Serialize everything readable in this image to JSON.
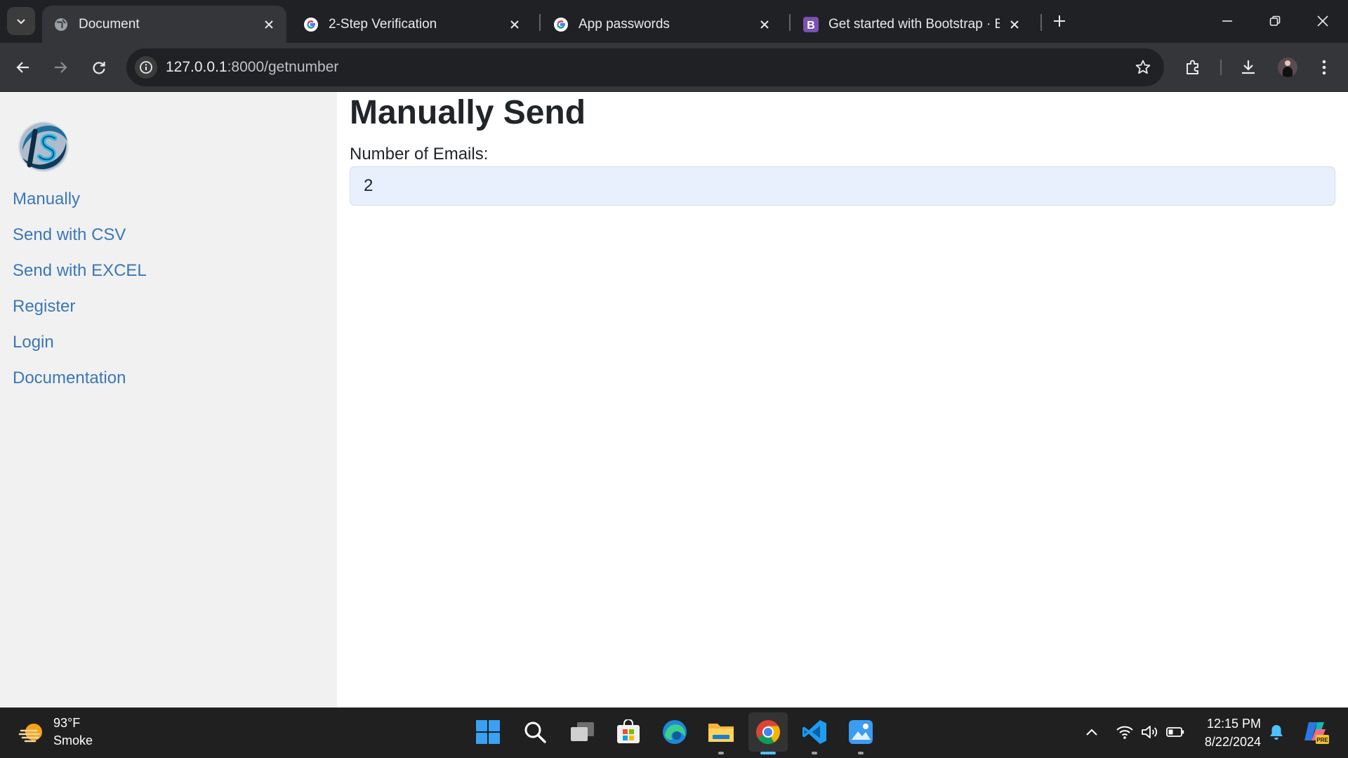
{
  "browser": {
    "tabs": [
      {
        "title": "Document",
        "active": true
      },
      {
        "title": "2-Step Verification",
        "active": false
      },
      {
        "title": "App passwords",
        "active": false
      },
      {
        "title": "Get started with Bootstrap · Bootstrap",
        "active": false
      }
    ],
    "bootstrap_favicon_letter": "B",
    "url_host": "127.0.0.1",
    "url_rest": ":8000/getnumber"
  },
  "sidebar": {
    "links": [
      "Manually",
      "Send with CSV",
      "Send with EXCEL",
      "Register",
      "Login",
      "Documentation"
    ]
  },
  "main": {
    "title": "Manually Send",
    "email_count_label": "Number of Emails:",
    "email_count_value": "2"
  },
  "taskbar": {
    "weather_temp": "93°F",
    "weather_condition": "Smoke",
    "time": "12:15 PM",
    "date": "8/22/2024",
    "copilot_badge": "PRE",
    "pinned_apps": [
      "start-icon",
      "search-icon",
      "task-view-icon",
      "store-icon",
      "edge-icon",
      "file-explorer-icon",
      "chrome-icon",
      "vscode-icon",
      "photos-icon"
    ]
  },
  "colors": {
    "link": "#3b77b7",
    "input_bg": "#e8f0fe",
    "sidebar_bg": "#f1f1f1",
    "browser_frame": "#202124",
    "toolbar": "#35363a",
    "taskbar": "#202020"
  }
}
